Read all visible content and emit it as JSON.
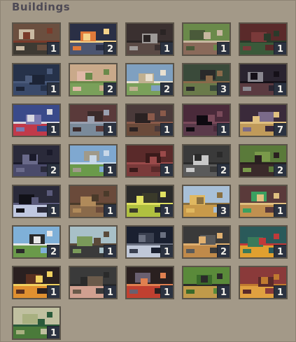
{
  "panel": {
    "title": "Buildings"
  },
  "buildings": [
    {
      "count": "1",
      "icon": "forge-workshop-icon",
      "colors": [
        "#6b4f3f",
        "#3e3a33",
        "#c9b9a2",
        "#7a3a2a"
      ]
    },
    {
      "count": "2",
      "icon": "fireball-icon",
      "colors": [
        "#2a2f45",
        "#4c5570",
        "#e07a3a",
        "#f4d28a"
      ]
    },
    {
      "count": "1",
      "icon": "wrench-tools-icon",
      "colors": [
        "#3a3030",
        "#5a4a45",
        "#9e9a98",
        "#2a2424"
      ]
    },
    {
      "count": "1",
      "icon": "farm-field-icon",
      "colors": [
        "#6a8a4a",
        "#8a6a5a",
        "#4a5a3a",
        "#c7b7a0"
      ]
    },
    {
      "count": "1",
      "icon": "crop-rows-icon",
      "colors": [
        "#5a2a2a",
        "#3a5a3a",
        "#7a3a3a",
        "#2a3a2a"
      ]
    },
    {
      "count": "1",
      "icon": "pine-forest-icon",
      "colors": [
        "#26324a",
        "#3a4a6a",
        "#1c2436",
        "#4a5a7a"
      ]
    },
    {
      "count": "2",
      "icon": "pig-pen-icon",
      "colors": [
        "#c9a98a",
        "#7aa05a",
        "#e0b8a8",
        "#6a8a4a"
      ]
    },
    {
      "count": "2",
      "icon": "sheep-field-icon",
      "colors": [
        "#7fa0c0",
        "#7aa05a",
        "#c0b090",
        "#e8e0d0"
      ]
    },
    {
      "count": "3",
      "icon": "lumber-camp-icon",
      "colors": [
        "#3a4a3a",
        "#6a7a4a",
        "#2a2a2a",
        "#8a6a4a"
      ]
    },
    {
      "count": "1",
      "icon": "tools-cave-icon",
      "colors": [
        "#2a2430",
        "#5a3a40",
        "#8a8890",
        "#151018"
      ]
    },
    {
      "count": "1",
      "icon": "sword-strike-icon",
      "colors": [
        "#3a4a8a",
        "#c03a4a",
        "#7a7ab0",
        "#d8d8e0"
      ]
    },
    {
      "count": "1",
      "icon": "hammer-anvil-icon",
      "colors": [
        "#5a3a3a",
        "#7a8a9a",
        "#3a2a2a",
        "#9aa0b0"
      ]
    },
    {
      "count": "1",
      "icon": "leather-hide-icon",
      "colors": [
        "#4a3a3a",
        "#6a4a3a",
        "#2a2222",
        "#8a5a4a"
      ]
    },
    {
      "count": "1",
      "icon": "mine-entrance-icon",
      "colors": [
        "#4a2a3a",
        "#5a3a4a",
        "#0e0a10",
        "#7a4a5a"
      ]
    },
    {
      "count": "7",
      "icon": "mine-cart-icon",
      "colors": [
        "#3a2a3a",
        "#c09a5a",
        "#7a6a8a",
        "#e0c080"
      ]
    },
    {
      "count": "2",
      "icon": "quarry-pick-icon",
      "colors": [
        "#2a2a3a",
        "#4a4a6a",
        "#6a6a8a",
        "#1a1a2a"
      ]
    },
    {
      "count": "1",
      "icon": "watch-tower-icon",
      "colors": [
        "#7fa8d0",
        "#6a9a4a",
        "#a09a8a",
        "#c8d8e8"
      ]
    },
    {
      "count": "1",
      "icon": "spear-rack-icon",
      "colors": [
        "#5a2a2a",
        "#7a3a3a",
        "#3a1a1a",
        "#9a4a4a"
      ]
    },
    {
      "count": "2",
      "icon": "cauldron-icon",
      "colors": [
        "#3a3a3a",
        "#5a5a5a",
        "#c8c8c8",
        "#2a2a2a"
      ]
    },
    {
      "count": "2",
      "icon": "woodcutter-hut-icon",
      "colors": [
        "#5a7a3a",
        "#3a2a2a",
        "#7a9a4a",
        "#2a2020"
      ]
    },
    {
      "count": "1",
      "icon": "gem-mine-icon",
      "colors": [
        "#2a2a3a",
        "#c0c8e0",
        "#111118",
        "#5a5a7a"
      ]
    },
    {
      "count": "1",
      "icon": "village-houses-icon",
      "colors": [
        "#6a4a3a",
        "#8a6a4a",
        "#b08a5a",
        "#4a3a2a"
      ]
    },
    {
      "count": "1",
      "icon": "glowing-runes-icon",
      "colors": [
        "#2a2a2a",
        "#b0c040",
        "#3a3a2a",
        "#e0e060"
      ]
    },
    {
      "count": "3",
      "icon": "wheat-field-icon",
      "colors": [
        "#a8c0d8",
        "#c89a4a",
        "#e0b860",
        "#8a7040"
      ]
    },
    {
      "count": "1",
      "icon": "amulet-ring-icon",
      "colors": [
        "#5a3a3a",
        "#c09050",
        "#3aa060",
        "#e0c080"
      ]
    },
    {
      "count": "2",
      "icon": "cattle-ranch-icon",
      "colors": [
        "#7fb0d8",
        "#6a9a4a",
        "#2a2a2a",
        "#e8e8e8"
      ]
    },
    {
      "count": "1",
      "icon": "windmill-icon",
      "colors": [
        "#a8c0c8",
        "#3a3a3a",
        "#7a9a5a",
        "#5a4a3a"
      ]
    },
    {
      "count": "1",
      "icon": "trap-circle-icon",
      "colors": [
        "#1a2030",
        "#c0c8d8",
        "#3a4050",
        "#6a7080"
      ]
    },
    {
      "count": "2",
      "icon": "cooking-pot-icon",
      "colors": [
        "#3a3a3a",
        "#c08a4a",
        "#5a5a5a",
        "#e0b070"
      ]
    },
    {
      "count": "1",
      "icon": "beehive-meadow-icon",
      "colors": [
        "#2a5a5a",
        "#e0a030",
        "#3a7a5a",
        "#c03a3a"
      ]
    },
    {
      "count": "1",
      "icon": "fire-pit-icon",
      "colors": [
        "#2a2020",
        "#e09030",
        "#5a3020",
        "#f0d060"
      ]
    },
    {
      "count": "1",
      "icon": "pig-barn-icon",
      "colors": [
        "#3a3a3a",
        "#d0a090",
        "#6a5a4a",
        "#2a2a2a"
      ]
    },
    {
      "count": "1",
      "icon": "campfire-pot-icon",
      "colors": [
        "#2a2020",
        "#c04030",
        "#6a6070",
        "#e08050"
      ]
    },
    {
      "count": "1",
      "icon": "well-meadow-icon",
      "colors": [
        "#5a8a3a",
        "#c09a4a",
        "#3a6a2a",
        "#2a2a2a"
      ]
    },
    {
      "count": "1",
      "icon": "wheat-bundle-icon",
      "colors": [
        "#8a3a3a",
        "#e0a040",
        "#5a2a2a",
        "#c07a30"
      ]
    },
    {
      "count": "1",
      "icon": "forest-grove-icon",
      "colors": [
        "#c0c0a0",
        "#4a7a3a",
        "#a8b080",
        "#2a5a3a"
      ]
    }
  ]
}
